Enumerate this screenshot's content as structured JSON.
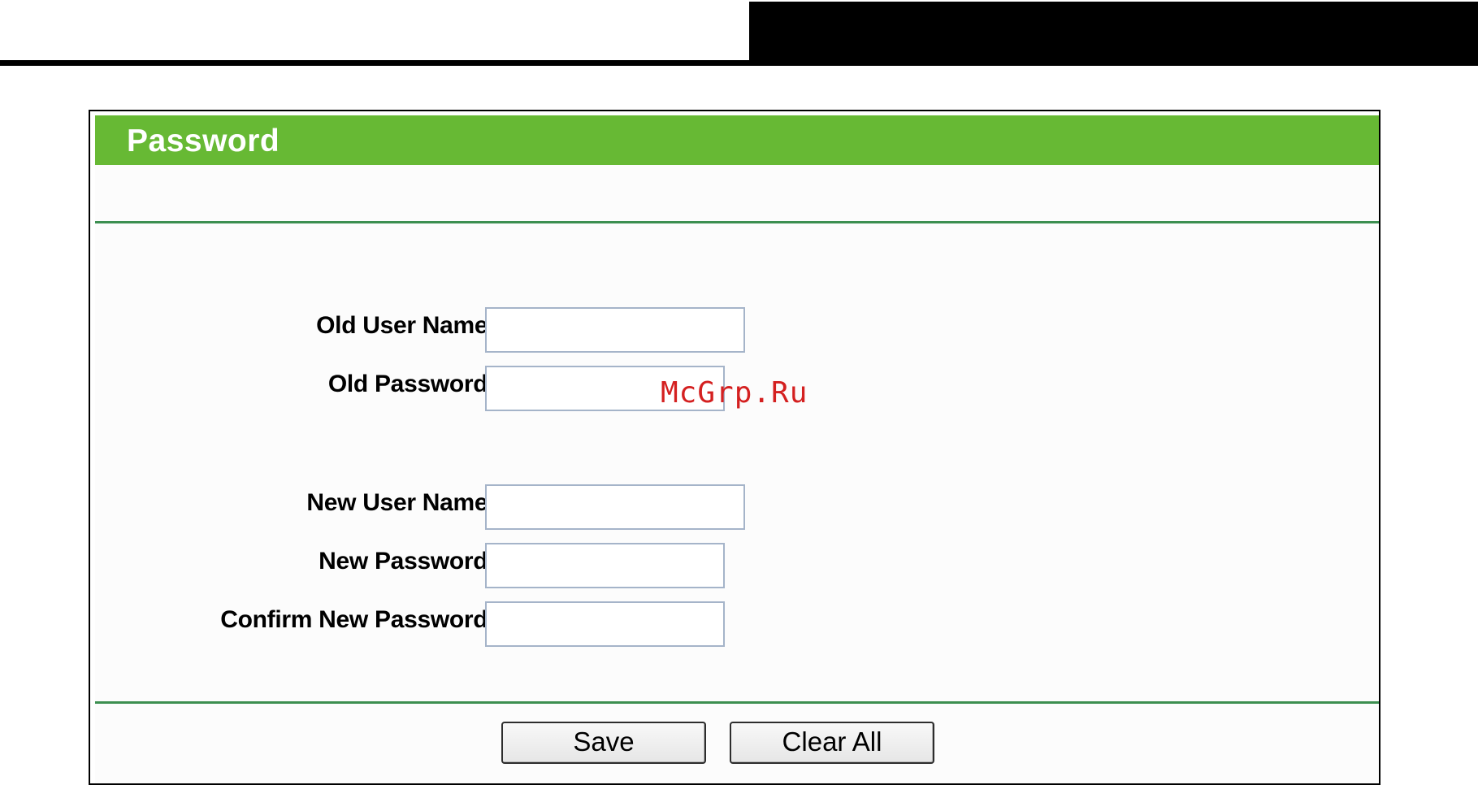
{
  "header": {
    "has_black_block": true
  },
  "panel": {
    "title": "Password",
    "colors": {
      "title_bar": "#67b934",
      "rule": "#3c8f50",
      "input_border": "#a5b4c9"
    }
  },
  "form": {
    "old_user_name": {
      "label": "Old User Name:",
      "value": ""
    },
    "old_password": {
      "label": "Old Password:",
      "value": ""
    },
    "new_user_name": {
      "label": "New User Name:",
      "value": ""
    },
    "new_password": {
      "label": "New Password:",
      "value": ""
    },
    "confirm_new_password": {
      "label": "Confirm New Password:",
      "value": ""
    }
  },
  "buttons": {
    "save_label": "Save",
    "clear_all_label": "Clear All"
  },
  "watermark": {
    "text": "McGrp.Ru"
  }
}
